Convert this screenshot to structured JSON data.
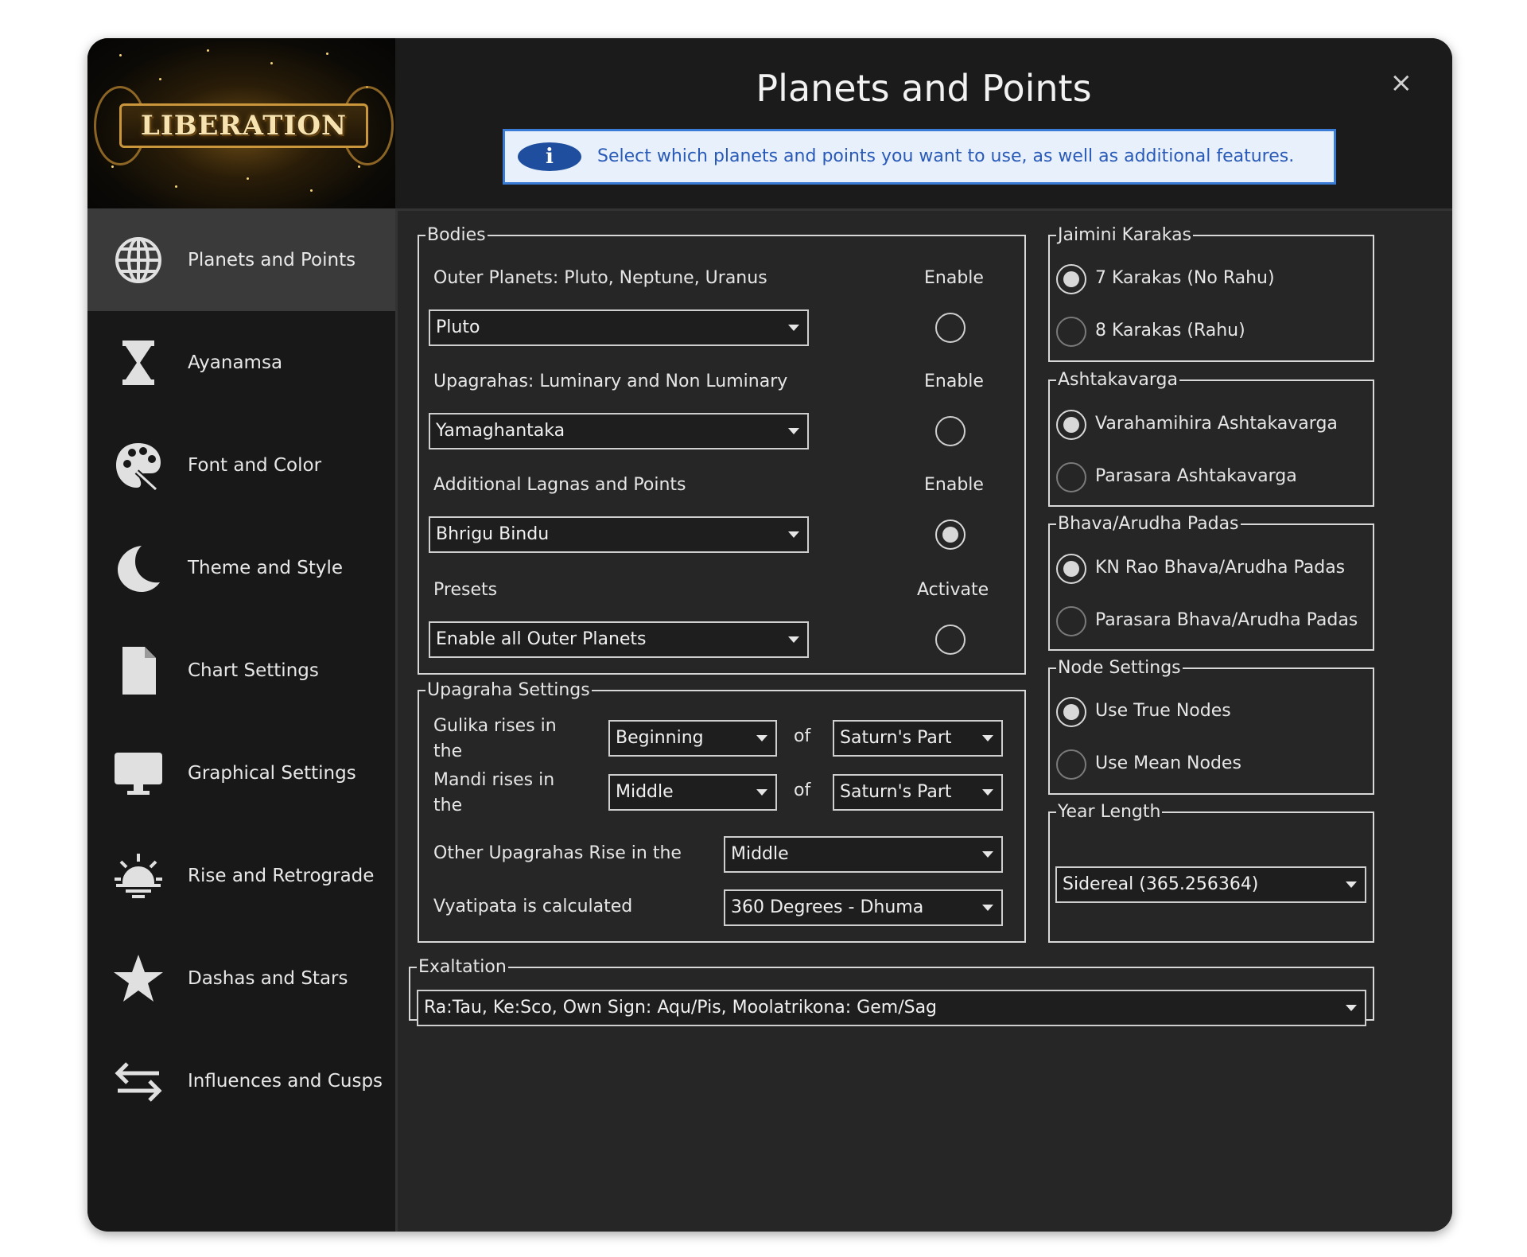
{
  "logo_text": "LIBERATION",
  "window": {
    "title": "Planets and Points",
    "close_glyph": "×"
  },
  "info": {
    "icon_glyph": "i",
    "text": "Select which planets and points you want to use, as well as additional features."
  },
  "sidebar": {
    "items": [
      {
        "label": "Planets and Points",
        "icon": "globe-icon",
        "active": true
      },
      {
        "label": "Ayanamsa",
        "icon": "hourglass-icon",
        "active": false
      },
      {
        "label": "Font and Color",
        "icon": "palette-icon",
        "active": false
      },
      {
        "label": "Theme and Style",
        "icon": "moon-icon",
        "active": false
      },
      {
        "label": "Chart Settings",
        "icon": "document-icon",
        "active": false
      },
      {
        "label": "Graphical Settings",
        "icon": "monitor-icon",
        "active": false
      },
      {
        "label": "Rise and Retrograde",
        "icon": "sunrise-icon",
        "active": false
      },
      {
        "label": "Dashas and Stars",
        "icon": "star-icon",
        "active": false
      },
      {
        "label": "Influences and Cusps",
        "icon": "arrows-swap-icon",
        "active": false
      }
    ]
  },
  "bodies": {
    "legend": "Bodies",
    "rows": [
      {
        "label": "Outer Planets: Pluto, Neptune, Uranus",
        "toggle_label": "Enable",
        "value": "Pluto",
        "checked": false
      },
      {
        "label": "Upagrahas: Luminary and Non Luminary",
        "toggle_label": "Enable",
        "value": "Yamaghantaka",
        "checked": false
      },
      {
        "label": "Additional Lagnas and Points",
        "toggle_label": "Enable",
        "value": "Bhrigu Bindu",
        "checked": true
      },
      {
        "label": "Presets",
        "toggle_label": "Activate",
        "value": "Enable all Outer Planets",
        "checked": false
      }
    ]
  },
  "upagraha": {
    "legend": "Upagraha Settings",
    "gulika_label": "Gulika rises in the",
    "gulika_pos": "Beginning",
    "of1": "of",
    "gulika_part": "Saturn's Part",
    "mandi_label": "Mandi rises in the",
    "mandi_pos": "Middle",
    "of2": "of",
    "mandi_part": "Saturn's Part",
    "other_label": "Other Upagrahas Rise in the",
    "other_value": "Middle",
    "vyatipata_label": "Vyatipata is calculated",
    "vyatipata_value": "360 Degrees - Dhuma"
  },
  "jaimini": {
    "legend": "Jaimini Karakas",
    "options": [
      "7 Karakas (No Rahu)",
      "8 Karakas (Rahu)"
    ],
    "selected": 0
  },
  "ashtakavarga": {
    "legend": "Ashtakavarga",
    "options": [
      "Varahamihira Ashtakavarga",
      "Parasara Ashtakavarga"
    ],
    "selected": 0
  },
  "padas": {
    "legend": "Bhava/Arudha Padas",
    "options": [
      "KN Rao Bhava/Arudha Padas",
      "Parasara Bhava/Arudha Padas"
    ],
    "selected": 0
  },
  "nodes": {
    "legend": "Node Settings",
    "options": [
      "Use True Nodes",
      "Use Mean Nodes"
    ],
    "selected": 0
  },
  "year": {
    "legend": "Year Length",
    "value": "Sidereal (365.256364)"
  },
  "exaltation": {
    "legend": "Exaltation",
    "value": "Ra:Tau, Ke:Sco, Own Sign: Aqu/Pis, Moolatrikona: Gem/Sag"
  }
}
